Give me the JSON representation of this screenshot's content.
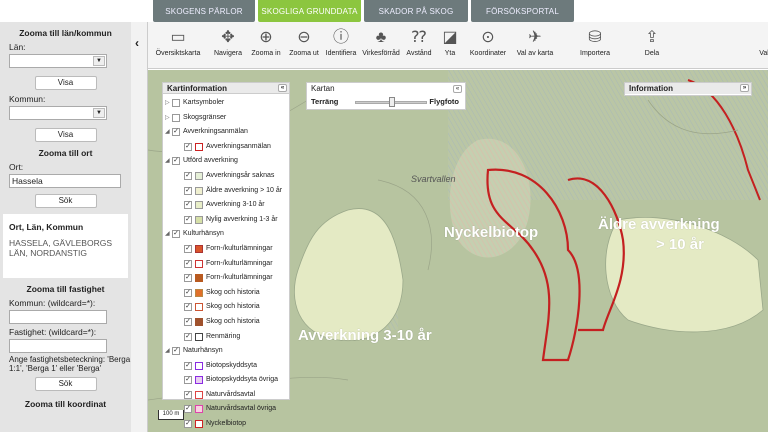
{
  "tabs": [
    {
      "label": "SKOGENS PÄRLOR",
      "active": false
    },
    {
      "label": "SKOGLIGA GRUNDDATA",
      "active": true
    },
    {
      "label": "SKADOR PÅ SKOG",
      "active": false
    },
    {
      "label": "FÖRSÖKSPORTAL",
      "active": false
    }
  ],
  "sidebar": {
    "lan_kommun_title": "Zooma till län/kommun",
    "lan_label": "Län:",
    "lan_value": "",
    "visa1": "Visa",
    "kommun_label": "Kommun:",
    "kommun_value": "",
    "visa2": "Visa",
    "ort_title": "Zooma till ort",
    "ort_label": "Ort:",
    "ort_value": "Hassela",
    "sok1": "Sök",
    "result_header": "Ort, Län, Kommun",
    "result_value": "HASSELA, GÄVLEBORGS LÄN, NORDANSTIG",
    "fastighet_title": "Zooma till fastighet",
    "fast_kommun_label": "Kommun: (wildcard=*):",
    "fast_kommun_value": "",
    "fastighet_label": "Fastighet: (wildcard=*):",
    "fastighet_value": "",
    "note": "Ange fastighetsbeteckning: 'Berga 1:1', 'Berga 1' eller 'Berga'",
    "sok2": "Sök",
    "koordinat_title": "Zooma till koordinat",
    "collapse_glyph": "‹"
  },
  "toolbar": [
    {
      "label": "Översiktskarta",
      "icon": "overview-map-icon"
    },
    {
      "label": "Navigera",
      "icon": "pan-arrows-icon"
    },
    {
      "label": "Zooma in",
      "icon": "zoom-in-icon"
    },
    {
      "label": "Zooma ut",
      "icon": "zoom-out-icon"
    },
    {
      "label": "Identifiera",
      "icon": "info-icon"
    },
    {
      "label": "Virkesförråd",
      "icon": "tree-icon"
    },
    {
      "label": "Avstånd",
      "icon": "ruler-icon"
    },
    {
      "label": "Yta",
      "icon": "area-icon"
    },
    {
      "label": "Koordinater",
      "icon": "crosshair-icon"
    },
    {
      "label": "Val av karta",
      "icon": "map-select-icon"
    },
    {
      "label": "Importera",
      "icon": "database-import-icon"
    },
    {
      "label": "Dela",
      "icon": "share-icon"
    },
    {
      "label": "Val av utskrift",
      "icon": "printer-icon"
    }
  ],
  "kartinfo": {
    "title": "Kartinformation",
    "collapse": "«",
    "items": [
      {
        "label": "Kartsymboler",
        "level": 0,
        "checked": false,
        "expand": "▷"
      },
      {
        "label": "Skogsgränser",
        "level": 0,
        "checked": false,
        "expand": "▷"
      },
      {
        "label": "Avverkningsanmälan",
        "level": 0,
        "checked": true,
        "expand": "◢"
      },
      {
        "label": "Avverkningsanmälan",
        "level": 1,
        "checked": true,
        "swatch": "#ffffff",
        "border": "#cc2222"
      },
      {
        "label": "Utförd avverkning",
        "level": 0,
        "checked": true,
        "expand": "◢"
      },
      {
        "label": "Avverkningsår saknas",
        "level": 1,
        "checked": true,
        "swatch": "#e6f0d8",
        "border": "#999"
      },
      {
        "label": "Äldre avverkning > 10 år",
        "level": 1,
        "checked": true,
        "swatch": "#f0f0d0",
        "border": "#999"
      },
      {
        "label": "Avverkning 3-10 år",
        "level": 1,
        "checked": true,
        "swatch": "#e8eec8",
        "border": "#999"
      },
      {
        "label": "Nylig avverkning 1-3 år",
        "level": 1,
        "checked": true,
        "swatch": "#d6e0a8",
        "border": "#999"
      },
      {
        "label": "Kulturhänsyn",
        "level": 0,
        "checked": true,
        "expand": "◢"
      },
      {
        "label": "Forn-/kulturlämningar",
        "level": 1,
        "checked": true,
        "swatch": "#d9552b",
        "border": "#a33"
      },
      {
        "label": "Forn-/kulturlämningar",
        "level": 1,
        "checked": true,
        "swatch": "#ffffff",
        "border": "#c33"
      },
      {
        "label": "Forn-/kulturlämningar",
        "level": 1,
        "checked": true,
        "swatch": "#b85a20",
        "border": "#b85a20"
      },
      {
        "label": "Skog och historia",
        "level": 1,
        "checked": true,
        "swatch": "#e0702a",
        "border": "#b84"
      },
      {
        "label": "Skog och historia",
        "level": 1,
        "checked": true,
        "swatch": "#ffffff",
        "border": "#c53"
      },
      {
        "label": "Skog och historia",
        "level": 1,
        "checked": true,
        "swatch": "#a0522d",
        "border": "#a0522d"
      },
      {
        "label": "Renmäring",
        "level": 1,
        "checked": true,
        "swatch": "#ffffff",
        "border": "#444"
      },
      {
        "label": "Naturhänsyn",
        "level": 0,
        "checked": true,
        "expand": "◢"
      },
      {
        "label": "Biotopskyddsyta",
        "level": 1,
        "checked": true,
        "swatch": "#ffffff",
        "border": "#8a2be2"
      },
      {
        "label": "Biotopskyddsyta övriga",
        "level": 1,
        "checked": true,
        "swatch": "#e8d0f0",
        "border": "#8a2be2"
      },
      {
        "label": "Naturvårdsavtal",
        "level": 1,
        "checked": true,
        "swatch": "#ffffff",
        "border": "#d44"
      },
      {
        "label": "Naturvårdsavtal övriga",
        "level": 1,
        "checked": true,
        "swatch": "#f8d0e0",
        "border": "#d4a"
      },
      {
        "label": "Nyckelbiotop",
        "level": 1,
        "checked": true,
        "swatch": "#ffffff",
        "border": "#cc2222"
      }
    ]
  },
  "kartan": {
    "title": "Kartan",
    "left": "Terräng",
    "right": "Flygfoto",
    "collapse": "«",
    "slider": 0.52
  },
  "information": {
    "title": "Information",
    "collapse": "»"
  },
  "map_labels": {
    "nyckelbiotop": "Nyckelbiotop",
    "aldre1": "Äldre avverkning",
    "aldre2": "> 10 år",
    "avverkning": "Avverkning 3-10 år",
    "place": "Svartvallen",
    "scale": "100 m"
  },
  "colors": {
    "tab_active": "#8cc63f",
    "tab_inactive": "#6d7a7c",
    "map_base": "#b9c5a1",
    "boundary": "#cc2222",
    "harvest_fill": "#e6ecc4"
  }
}
